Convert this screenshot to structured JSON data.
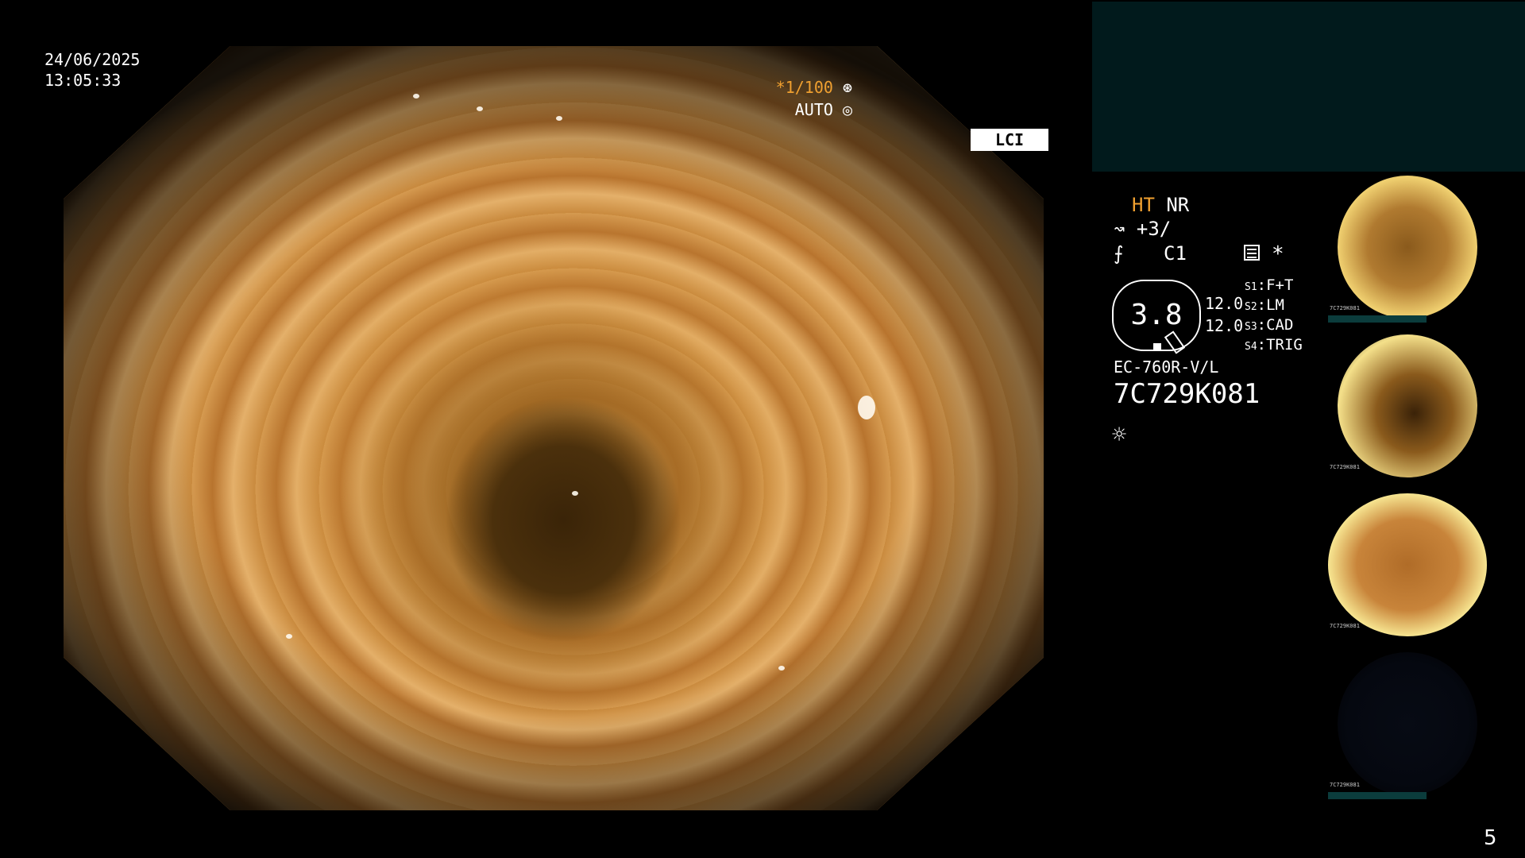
{
  "datetime": {
    "date": "24/06/2025",
    "time": "13:05:33"
  },
  "overlay": {
    "zoom": "*1/100",
    "auto": "AUTO",
    "mode": "LCI"
  },
  "panel": {
    "ht": "HT",
    "nr": "NR",
    "enhance": "+3/",
    "color": "C1",
    "star": "*",
    "hex_value": "3.8",
    "value_1": "12.0",
    "value_2": "12.0",
    "switches": [
      {
        "key": "S1",
        "label": "F+T"
      },
      {
        "key": "S2",
        "label": "LM"
      },
      {
        "key": "S3",
        "label": "CAD"
      },
      {
        "key": "S4",
        "label": "TRIG"
      }
    ],
    "model": "EC-760R-V/L",
    "serial": "7C729K081"
  },
  "thumbnails": [
    {
      "caption": "7C729K081"
    },
    {
      "caption": "7C729K081"
    },
    {
      "caption": "7C729K081"
    },
    {
      "caption": "7C729K081"
    }
  ],
  "page_number": "5",
  "colors": {
    "accent": "#f0a030",
    "panel_teal": "#011a1c",
    "thumb_bar": "#0b3c3c"
  },
  "icons": [
    "shutter-icon",
    "iris-icon",
    "enhance-icon",
    "color-icon",
    "menu-icon",
    "light-icon"
  ]
}
